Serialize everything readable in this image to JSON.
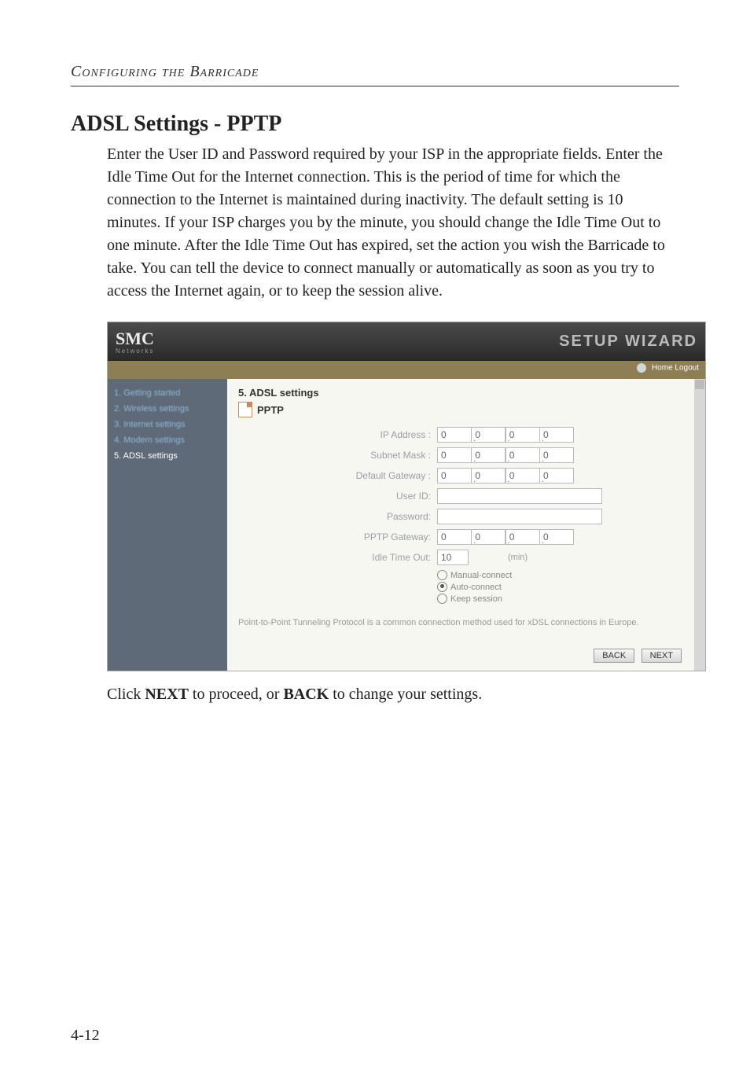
{
  "running_head": "Configuring the Barricade",
  "section_title": "ADSL Settings - PPTP",
  "body_paragraph": "Enter the User ID and Password required by your ISP in the appropriate fields. Enter the Idle Time Out for the Internet connection. This is the period of time for which the connection to the Internet is maintained during inactivity. The default setting is 10 minutes. If your ISP charges you by the minute, you should change the Idle Time Out to one minute. After the Idle Time Out has expired, set the action you wish the Barricade to take. You can tell the device to connect manually or automatically as soon as you try to access the Internet again, or to keep the session alive.",
  "after_text_prefix": "Click ",
  "after_text_next": "NEXT",
  "after_text_mid": " to proceed, or ",
  "after_text_back": "BACK",
  "after_text_suffix": " to change your settings.",
  "page_number": "4-12",
  "shot": {
    "logo": "SMC",
    "logo_sub": "Networks",
    "wizard": "SETUP WIZARD",
    "toplinks": "Home   Logout",
    "sidebar": {
      "items": [
        "1. Getting started",
        "2. Wireless settings",
        "3. Internet settings",
        "4. Modem settings",
        "5. ADSL settings"
      ],
      "active_index": 4
    },
    "content": {
      "title": "5. ADSL settings",
      "subtype": "PPTP",
      "fields": {
        "ip_address_label": "IP Address :",
        "subnet_mask_label": "Subnet Mask :",
        "default_gateway_label": "Default Gateway :",
        "user_id_label": "User ID:",
        "password_label": "Password:",
        "pptp_gateway_label": "PPTP Gateway:",
        "idle_time_out_label": "Idle Time Out:",
        "idle_time_out_value": "10",
        "idle_time_out_unit": "(min)",
        "ip_address": [
          "0",
          "0",
          "0",
          "0"
        ],
        "subnet_mask": [
          "0",
          "0",
          "0",
          "0"
        ],
        "default_gateway": [
          "0",
          "0",
          "0",
          "0"
        ],
        "pptp_gateway": [
          "0",
          "0",
          "0",
          "0"
        ],
        "user_id_value": "",
        "password_value": "",
        "radio_manual": "Manual-connect",
        "radio_auto": "Auto-connect",
        "radio_keep": "Keep session",
        "radio_selected": "auto"
      },
      "footnote": "Point-to-Point Tunneling Protocol is a common connection method used for xDSL connections in Europe.",
      "buttons": {
        "back": "BACK",
        "next": "NEXT"
      }
    }
  }
}
